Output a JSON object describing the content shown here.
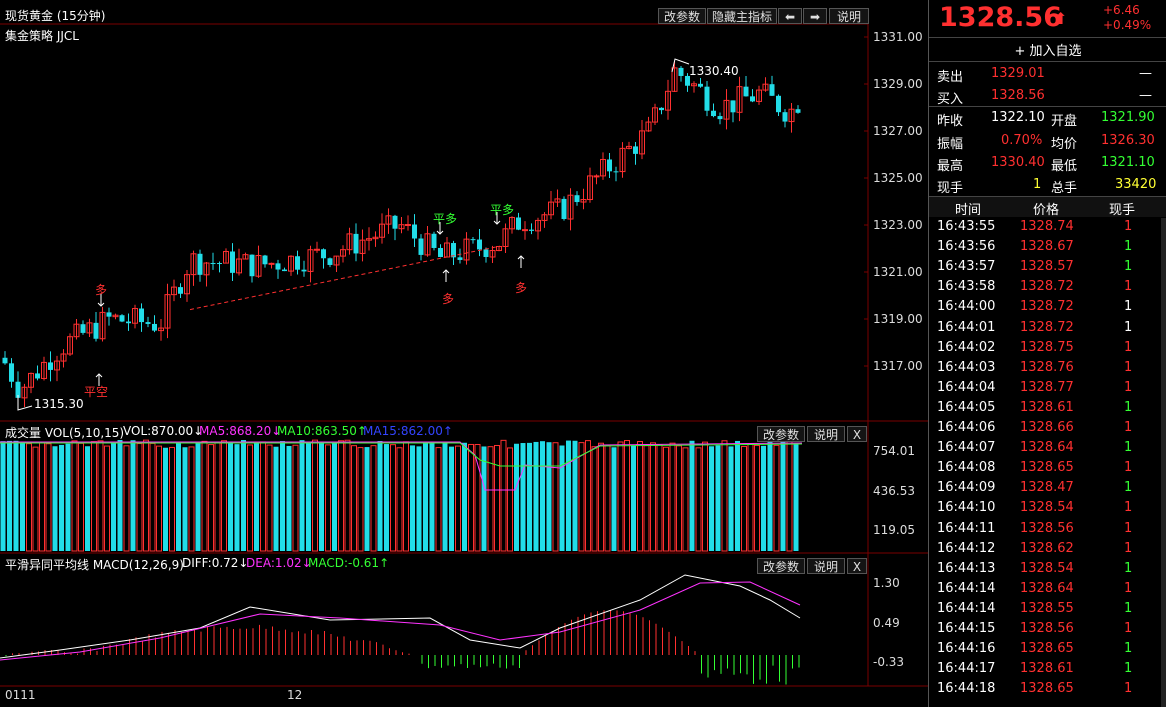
{
  "header": {
    "title": "现货黄金 (15分钟)",
    "strategy": "集金策略 JJCL",
    "buttons": [
      "改参数",
      "隐藏主指标",
      "⬅",
      "➡",
      "说明"
    ]
  },
  "main_chart": {
    "price_axis": [
      "1331.00",
      "1329.00",
      "1327.00",
      "1325.00",
      "1323.00",
      "1321.00",
      "1319.00",
      "1317.00"
    ],
    "high_label": "1330.40",
    "low_label": "1315.30",
    "signals": [
      "多",
      "平空",
      "平多",
      "多",
      "平多",
      "多"
    ]
  },
  "volume_panel": {
    "title": "成交量 VOL(5,10,15)",
    "vol": "VOL:870.00↓",
    "ma5": "MA5:868.20↓",
    "ma10": "MA10:863.50↑",
    "ma15": "MA15:862.00↑",
    "axis": [
      "754.01",
      "436.53",
      "119.05"
    ],
    "buttons": [
      "改参数",
      "说明",
      "X"
    ]
  },
  "macd_panel": {
    "title": "平滑异同平均线 MACD(12,26,9)",
    "diff": "DIFF:0.72↓",
    "dea": "DEA:1.02↓",
    "macd": "MACD:-0.61↑",
    "axis": [
      "1.30",
      "0.49",
      "-0.33"
    ],
    "buttons": [
      "改参数",
      "说明",
      "X"
    ]
  },
  "time_axis": [
    "0111",
    "12"
  ],
  "colors": {
    "up": "#ff3030",
    "down": "#22dde8",
    "diff": "#ffffff",
    "dea": "#ff33ff",
    "ma10": "#33ff33",
    "ma15": "#3344ff"
  },
  "quote": {
    "price": "1328.56",
    "arrow": "⬆",
    "change": "+6.46",
    "change_pct": "+0.49%",
    "add_watch": "+ 加入自选",
    "sell_label": "卖出",
    "sell_price": "1329.01",
    "sell_vol": "—",
    "buy_label": "买入",
    "buy_price": "1328.56",
    "buy_vol": "—",
    "prev_close_label": "昨收",
    "prev_close": "1322.10",
    "open_label": "开盘",
    "open": "1321.90",
    "amp_label": "振幅",
    "amp": "0.70%",
    "avg_label": "均价",
    "avg": "1326.30",
    "high_label": "最高",
    "high": "1330.40",
    "low_label": "最低",
    "low": "1321.10",
    "now_vol_label": "现手",
    "now_vol": "1",
    "total_vol_label": "总手",
    "total_vol": "33420",
    "tick_headers": [
      "时间",
      "价格",
      "现手"
    ],
    "ticks": [
      [
        "16:43:55",
        "1328.74",
        "1",
        "red"
      ],
      [
        "16:43:56",
        "1328.67",
        "1",
        "green"
      ],
      [
        "16:43:57",
        "1328.57",
        "1",
        "green"
      ],
      [
        "16:43:58",
        "1328.72",
        "1",
        "red"
      ],
      [
        "16:44:00",
        "1328.72",
        "1",
        "white"
      ],
      [
        "16:44:01",
        "1328.72",
        "1",
        "white"
      ],
      [
        "16:44:02",
        "1328.75",
        "1",
        "red"
      ],
      [
        "16:44:03",
        "1328.76",
        "1",
        "red"
      ],
      [
        "16:44:04",
        "1328.77",
        "1",
        "red"
      ],
      [
        "16:44:05",
        "1328.61",
        "1",
        "green"
      ],
      [
        "16:44:06",
        "1328.66",
        "1",
        "red"
      ],
      [
        "16:44:07",
        "1328.64",
        "1",
        "green"
      ],
      [
        "16:44:08",
        "1328.65",
        "1",
        "red"
      ],
      [
        "16:44:09",
        "1328.47",
        "1",
        "green"
      ],
      [
        "16:44:10",
        "1328.54",
        "1",
        "red"
      ],
      [
        "16:44:11",
        "1328.56",
        "1",
        "red"
      ],
      [
        "16:44:12",
        "1328.62",
        "1",
        "red"
      ],
      [
        "16:44:13",
        "1328.54",
        "1",
        "green"
      ],
      [
        "16:44:14",
        "1328.64",
        "1",
        "red"
      ],
      [
        "16:44:14",
        "1328.55",
        "1",
        "green"
      ],
      [
        "16:44:15",
        "1328.56",
        "1",
        "red"
      ],
      [
        "16:44:16",
        "1328.65",
        "1",
        "green"
      ],
      [
        "16:44:17",
        "1328.61",
        "1",
        "green"
      ],
      [
        "16:44:18",
        "1328.65",
        "1",
        "red"
      ]
    ]
  }
}
